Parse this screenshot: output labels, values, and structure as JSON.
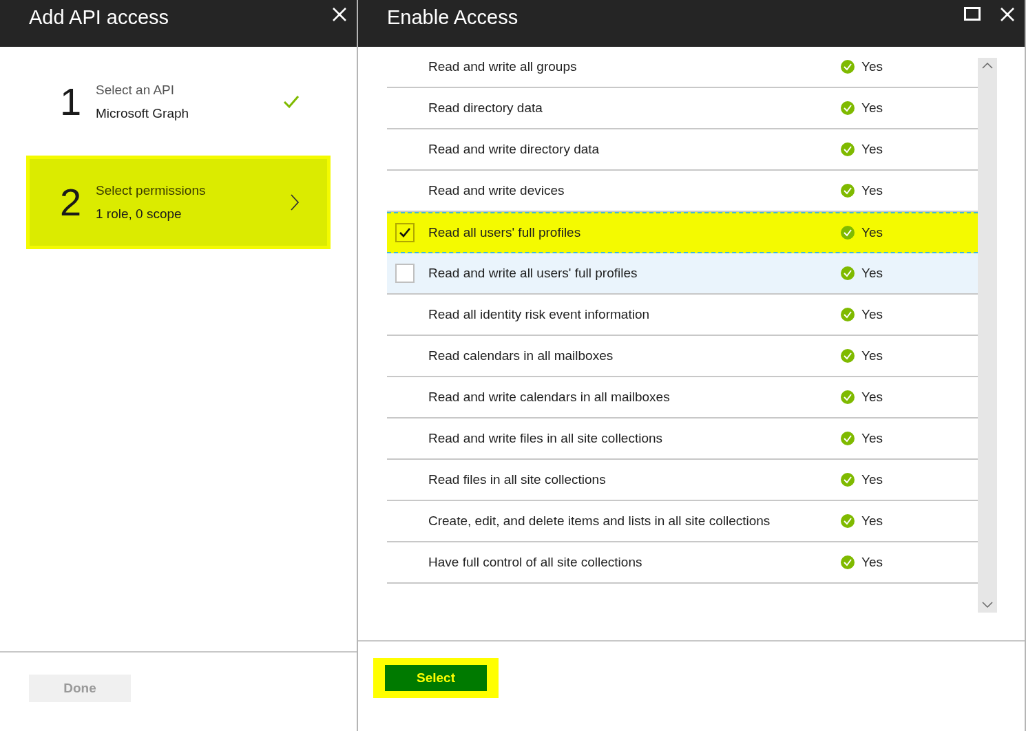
{
  "left_blade": {
    "title": "Add API access",
    "steps": [
      {
        "number": "1",
        "title": "Select an API",
        "detail": "Microsoft Graph",
        "selected": false,
        "kind": "done"
      },
      {
        "number": "2",
        "title": "Select permissions",
        "detail": "1 role, 0 scope",
        "selected": true,
        "kind": "next"
      }
    ],
    "done_button": {
      "label": "Done",
      "disabled": true
    }
  },
  "right_blade": {
    "title": "Enable Access",
    "permissions": [
      {
        "name": "Read and write all groups",
        "admin": "Yes",
        "checked": false,
        "hovered": false
      },
      {
        "name": "Read directory data",
        "admin": "Yes",
        "checked": false,
        "hovered": false
      },
      {
        "name": "Read and write directory data",
        "admin": "Yes",
        "checked": false,
        "hovered": false
      },
      {
        "name": "Read and write devices",
        "admin": "Yes",
        "checked": false,
        "hovered": false
      },
      {
        "name": "Read all users' full profiles",
        "admin": "Yes",
        "checked": true,
        "hovered": false
      },
      {
        "name": "Read and write all users' full profiles",
        "admin": "Yes",
        "checked": false,
        "hovered": true
      },
      {
        "name": "Read all identity risk event information",
        "admin": "Yes",
        "checked": false,
        "hovered": false
      },
      {
        "name": "Read calendars in all mailboxes",
        "admin": "Yes",
        "checked": false,
        "hovered": false
      },
      {
        "name": "Read and write calendars in all mailboxes",
        "admin": "Yes",
        "checked": false,
        "hovered": false
      },
      {
        "name": "Read and write files in all site collections",
        "admin": "Yes",
        "checked": false,
        "hovered": false
      },
      {
        "name": "Read files in all site collections",
        "admin": "Yes",
        "checked": false,
        "hovered": false
      },
      {
        "name": "Create, edit, and delete items and lists in all site collections",
        "admin": "Yes",
        "checked": false,
        "hovered": false
      },
      {
        "name": "Have full control of all site collections",
        "admin": "Yes",
        "checked": false,
        "hovered": false
      }
    ],
    "select_button": {
      "label": "Select"
    }
  }
}
